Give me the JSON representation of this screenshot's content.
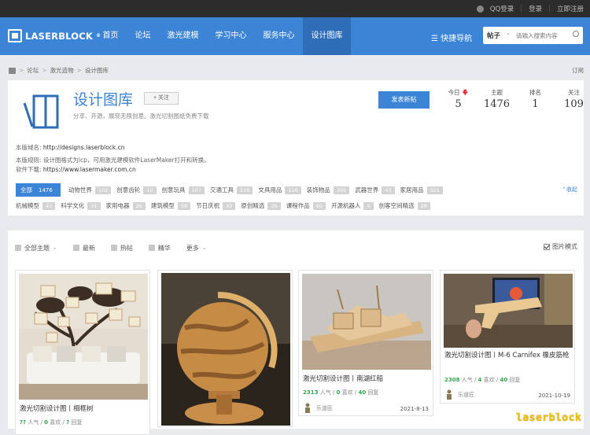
{
  "topbar": {
    "qq_login": "QQ登录",
    "login": "登录",
    "register": "立即注册"
  },
  "brand": {
    "name": "LASERBLOCK",
    "trademark": "®",
    "accent": "#3b84d6"
  },
  "nav": {
    "items": [
      {
        "label": "首页"
      },
      {
        "label": "论坛"
      },
      {
        "label": "激光建模"
      },
      {
        "label": "学习中心"
      },
      {
        "label": "服务中心"
      },
      {
        "label": "设计图库",
        "active": true
      }
    ],
    "quick_nav": "快捷导航",
    "search_type": "帖子",
    "search_placeholder": "请输入搜索内容"
  },
  "breadcrumb": [
    "论坛",
    "激光造物",
    "设计图库"
  ],
  "breadcrumb_sep": ">",
  "subscribe": "订阅",
  "forum": {
    "title": "设计图库",
    "follow_label": "+ 关注",
    "description": "分享、开源，展现无限创意。激光切割图纸免费下载",
    "post_button": "发表新帖",
    "stats": [
      {
        "label": "今日",
        "value": "5",
        "trend": "down"
      },
      {
        "label": "主题",
        "value": "1476"
      },
      {
        "label": "排名",
        "value": "1"
      },
      {
        "label": "关注",
        "value": "109"
      }
    ],
    "domain_label": "本版域名:",
    "domain": "http://designs.laserblock.cn",
    "rules_label": "本版规则:",
    "rules": "设计图格式为lcp，可用激光建模软件LaserMaker打开和转换。",
    "software_label": "软件下载:",
    "software": "https://www.lasermaker.com.cn",
    "collapse": "收起"
  },
  "tags_row1": [
    {
      "label": "全部",
      "count": "1476",
      "active": true
    },
    {
      "label": "动物世界",
      "count": "102"
    },
    {
      "label": "创意齿轮",
      "count": "10"
    },
    {
      "label": "创意玩具",
      "count": "107"
    },
    {
      "label": "交通工具",
      "count": "119"
    },
    {
      "label": "文具用品",
      "count": "116"
    },
    {
      "label": "装饰物品",
      "count": "305"
    },
    {
      "label": "武器世界",
      "count": "43"
    },
    {
      "label": "家居用品",
      "count": "321"
    }
  ],
  "tags_row2": [
    {
      "label": "机械模型",
      "count": "43"
    },
    {
      "label": "科学文化",
      "count": "31"
    },
    {
      "label": "家用电器",
      "count": "26"
    },
    {
      "label": "建筑模型",
      "count": "58"
    },
    {
      "label": "节日庆祝",
      "count": "32"
    },
    {
      "label": "原创精选",
      "count": "26"
    },
    {
      "label": "课程作品",
      "count": "60"
    },
    {
      "label": "开源机器人",
      "count": "4"
    },
    {
      "label": "创客空间精选",
      "count": "26"
    }
  ],
  "toolbar": {
    "all_topics": "全部主题",
    "latest": "最新",
    "hot": "热帖",
    "digest": "精华",
    "more": "更多",
    "pic_mode": "图片模式"
  },
  "cards": [
    {
      "title": "激光切割设计图丨相框树",
      "views": "??",
      "likes": "0",
      "replies": "?",
      "views_label": "人气",
      "likes_label": "喜欢",
      "replies_label": "回复",
      "user": "",
      "date": ""
    },
    {
      "title": "",
      "views": "",
      "likes": "",
      "replies": "",
      "user": "",
      "date": ""
    },
    {
      "title": "激光切割设计图丨南湖红船",
      "views": "2313",
      "likes": "0",
      "replies": "40",
      "views_label": "人气",
      "likes_label": "喜欢",
      "replies_label": "回复",
      "user": "乐道匠",
      "date": "2021-8-13"
    },
    {
      "title": "激光切割设计图丨M-6 Carnifex 橡皮筋枪",
      "views": "2308",
      "likes": "4",
      "replies": "40",
      "views_label": "人气",
      "likes_label": "喜欢",
      "replies_label": "回复",
      "user": "乐道匠",
      "date": "2021-10-19"
    }
  ],
  "watermark": "laserblock"
}
